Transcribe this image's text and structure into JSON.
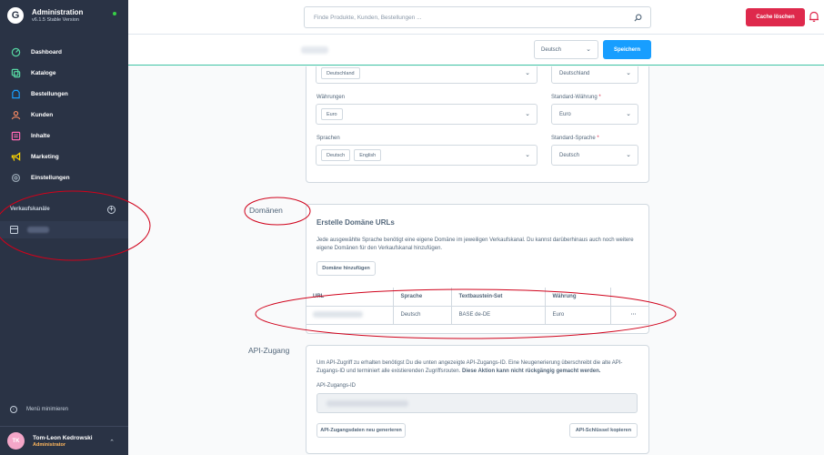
{
  "sidebar": {
    "brand_title": "Administration",
    "brand_version": "v6.1.5 Stable Version",
    "items": [
      {
        "label": "Dashboard",
        "icon": "dashboard-icon",
        "color": "#57d9a3"
      },
      {
        "label": "Kataloge",
        "icon": "catalog-icon",
        "color": "#57d9a3"
      },
      {
        "label": "Bestellungen",
        "icon": "orders-icon",
        "color": "#189eff"
      },
      {
        "label": "Kunden",
        "icon": "customers-icon",
        "color": "#f88962"
      },
      {
        "label": "Inhalte",
        "icon": "content-icon",
        "color": "#ff68b4"
      },
      {
        "label": "Marketing",
        "icon": "marketing-icon",
        "color": "#ffd700"
      },
      {
        "label": "Einstellungen",
        "icon": "settings-icon",
        "color": "#9aa8b5"
      }
    ],
    "channels_label": "Verkaufskanäle",
    "minimize_label": "Menü minimieren",
    "user": {
      "initials": "TK",
      "name": "Tom-Leon Kedrowski",
      "role": "Administrator"
    }
  },
  "topbar": {
    "search_placeholder": "Finde Produkte, Kunden, Bestellungen ...",
    "cache_button": "Cache löschen"
  },
  "smartbar": {
    "language_value": "Deutsch",
    "save_button": "Speichern"
  },
  "config": {
    "countries": {
      "tags": [
        "Deutschland"
      ],
      "default_value": "Deutschland"
    },
    "currencies": {
      "label": "Währungen",
      "tags": [
        "Euro"
      ],
      "default_label": "Standard-Währung",
      "default_value": "Euro"
    },
    "languages": {
      "label": "Sprachen",
      "tags": [
        "Deutsch",
        "English"
      ],
      "default_label": "Standard-Sprache",
      "default_value": "Deutsch"
    }
  },
  "domains": {
    "section_title": "Domänen",
    "heading": "Erstelle Domäne URLs",
    "description": "Jede ausgewählte Sprache benötigt eine eigene Domäne im jeweiligen Verkaufskanal. Du kannst darüberhinaus auch noch weitere eigene Domänen für den Verkaufskanal hinzufügen.",
    "add_button": "Domäne hinzufügen",
    "columns": [
      "URL",
      "Sprache",
      "Textbaustein-Set",
      "Währung"
    ],
    "rows": [
      {
        "language": "Deutsch",
        "snippet_set": "BASE de-DE",
        "currency": "Euro",
        "actions": "···"
      }
    ]
  },
  "api": {
    "section_title": "API-Zugang",
    "description_plain": "Um API-Zugriff zu erhalten benötigst Du die unten angezeigte API-Zugangs-ID. Eine Neugenerierung überschreibt die alte API-Zugangs-ID und terminiert alle existierenden Zugriffsrouten.",
    "description_bold": "Diese Aktion kann nicht rückgängig gemacht werden.",
    "field_label": "API-Zugangs-ID",
    "regenerate_button": "API-Zugangsdaten neu generieren",
    "copy_button": "API-Schlüssel kopieren"
  },
  "colors": {
    "sidebar_bg": "#2a3345",
    "primary": "#189eff",
    "danger": "#de294c",
    "annotation": "#d0021b"
  }
}
